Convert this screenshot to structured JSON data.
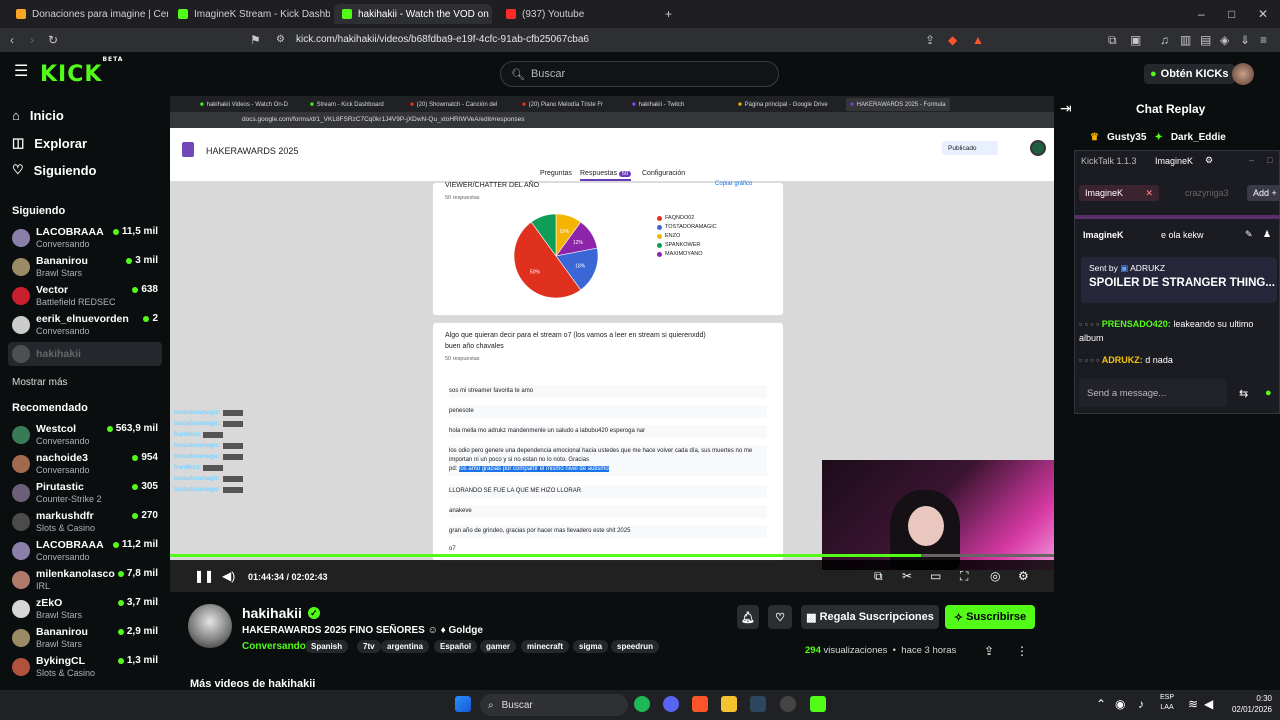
{
  "browser": {
    "tabs": [
      {
        "label": "Donaciones para imagine | Ceneka",
        "color": "#f6a623"
      },
      {
        "label": "ImagineK Stream - Kick Dashboar",
        "color": "#53fc18"
      },
      {
        "label": "hakihakii - Watch the VOD on",
        "color": "#53fc18"
      },
      {
        "label": "(937) Youtube",
        "color": "#ff2a2a"
      }
    ],
    "url": "kick.com/hakihakii/videos/b68fdba9-e19f-4cfc-91ab-cfb25067cba6"
  },
  "header": {
    "logo": "KICK",
    "logo_sup": "BETA",
    "search_placeholder": "Buscar",
    "kicks_button": "Obtén KICKs"
  },
  "sidebar": {
    "nav": [
      {
        "label": "Inicio",
        "icon": "home-icon"
      },
      {
        "label": "Explorar",
        "icon": "compass-icon"
      },
      {
        "label": "Siguiendo",
        "icon": "heart-icon"
      }
    ],
    "following_title": "Siguiendo",
    "following": [
      {
        "name": "LACOBRAAA",
        "category": "Conversando",
        "viewers": "11,5 mil",
        "color": "#8a7fa8"
      },
      {
        "name": "Bananirou",
        "category": "Brawl Stars",
        "viewers": "3 mil",
        "color": "#9b8a66"
      },
      {
        "name": "Vector",
        "category": "Battlefield REDSEC",
        "viewers": "638",
        "color": "#c8202c"
      },
      {
        "name": "eerik_elnuevorden",
        "category": "Conversando",
        "viewers": "2",
        "color": "#cccccc"
      },
      {
        "name": "hakihakii",
        "category": "",
        "viewers": "",
        "color": "#6a6a6a"
      }
    ],
    "show_more": "Mostrar más",
    "recommended_title": "Recomendado",
    "recommended": [
      {
        "name": "Westcol",
        "category": "Conversando",
        "viewers": "563,9 mil",
        "color": "#3b7a57"
      },
      {
        "name": "nachoide3",
        "category": "Conversando",
        "viewers": "954",
        "color": "#a36b4e"
      },
      {
        "name": "Pirutastic",
        "category": "Counter-Strike 2",
        "viewers": "305",
        "color": "#6b5f7a"
      },
      {
        "name": "markushdfr",
        "category": "Slots & Casino",
        "viewers": "270",
        "color": "#4b4b4b"
      },
      {
        "name": "LACOBRAAA",
        "category": "Conversando",
        "viewers": "11,2 mil",
        "color": "#8a7fa8"
      },
      {
        "name": "milenkanolasco",
        "category": "IRL",
        "viewers": "7,8 mil",
        "color": "#b07a6a"
      },
      {
        "name": "zEkO",
        "category": "Brawl Stars",
        "viewers": "3,7 mil",
        "color": "#d6d6d6"
      },
      {
        "name": "Bananirou",
        "category": "Brawl Stars",
        "viewers": "2,9 mil",
        "color": "#9b8a66"
      },
      {
        "name": "BykingCL",
        "category": "Slots & Casino",
        "viewers": "1,3 mil",
        "color": "#b0523d"
      }
    ]
  },
  "video": {
    "inner_tabs": [
      "hakihakii Videos - Watch On-D",
      "Stream - Kick Dashboard",
      "(20) Showmatch - Canción del",
      "(20) Piano Melodía Triste Fr",
      "hakihakii - Twitch",
      "Página principal - Google Drive",
      "HAKERAWARDS 2025 - Formula"
    ],
    "inner_url": "docs.google.com/forms/d/1_VKL8FSRzC7Cq0kr1J4V9P-jXDwN-Qu_xtoHRIWVeA/edit#responses",
    "form_title": "HAKERAWARDS 2025",
    "form_tabs": {
      "questions": "Preguntas",
      "responses": "Respuestas",
      "responses_count": "50",
      "settings": "Configuración"
    },
    "publish_label": "Publicado",
    "q1_title": "VIEWER/CHATTER DEL AÑO",
    "q1_count": "50 respuestas",
    "copy_chart": "Copiar gráfico",
    "pie_legend": [
      "FAQNDO02",
      "TOSTADORAMAGIC",
      "ENZO",
      "SPANKOWER",
      "MAXIMOYANO"
    ],
    "q2_title": "Algo que quieran decir para el stream o7 (los vamos a leer en stream si quierenxdd)",
    "q2_title2": "buen año chavales",
    "q2_count": "50 respuestas",
    "responses": [
      "sos mi streamer favorita te amo",
      "penesote",
      "hola mella mo adrukz mandenmenle un saludo a labubu420 esperoga nar",
      "los odio pero genere una dependencia emocional hacia ustedes que me hace volver cada día, sus muertes no me importan ni un poco y si no estan no lo noto. Gracias",
      "pd:",
      "los amo gracias por compartir el mismo nivel de autismo",
      "LLORANDO SE FUE LA QUE ME HIZO LLORAR",
      "anakeve",
      "gran año de grindeo, gracias por hacer mas llevadero este shit 2025",
      "o7"
    ],
    "overlay_chat": [
      "tostadoramagic:",
      "tostadoramagic:",
      "fran96xd:",
      "tostadoramagic:",
      "tostadoramagic:",
      "fran96xd:",
      "tostadoramagic:",
      "tostadoramagic:"
    ],
    "timecode": "01:44:34 / 02:02:43",
    "progress": 0.85
  },
  "chart_data": {
    "type": "pie",
    "title": "VIEWER/CHATTER DEL AÑO",
    "categories": [
      "FAQNDO02",
      "TOSTADORAMAGIC",
      "ENZO",
      "SPANKOWER",
      "MAXIMOYANO"
    ],
    "values": [
      50,
      18,
      10,
      10,
      12
    ],
    "colors": [
      "#e0301e",
      "#3b67d6",
      "#f4b400",
      "#0f9d58",
      "#8e24aa"
    ],
    "labels": [
      "50%",
      "18%",
      "10%",
      "",
      "12%"
    ]
  },
  "chat": {
    "title": "Chat Replay",
    "user1": "Gusty35",
    "user2": "Dark_Eddie",
    "kicktalk_title": "KickTalk 1.1.3",
    "kicktalk_user": "ImagineK",
    "tab1": "ImagineK",
    "tab2": "crazyniga3",
    "add": "Add",
    "chan_name": "ImagineK",
    "chan_title": "e ola kekw",
    "sent_by": "Sent by",
    "sender": "ADRUKZ",
    "pinned": "SPOILER DE STRANGER THING...",
    "msg1_user": "PRENSADO420:",
    "msg1_text": "leakeando su ultimo album",
    "msg2_user": "ADRUKZ:",
    "msg2_text": "d nada",
    "input_placeholder": "Send a message..."
  },
  "channel": {
    "name": "hakihakii",
    "title": "HAKERAWARDS 2025 FINO SEÑORES",
    "game_suffix": "Goldge",
    "category": "Conversando",
    "tags": [
      "Spanish",
      "7tv",
      "argentina",
      "Español",
      "gamer",
      "minecraft",
      "sigma",
      "speedrun"
    ],
    "gift_button": "Regala Suscripciones",
    "sub_button": "Suscribirse",
    "views_count": "294",
    "views_label": "visualizaciones",
    "ago": "hace 3 horas",
    "more_videos": "Más videos de hakihakii"
  },
  "taskbar": {
    "search": "Buscar",
    "lang1": "ESP",
    "lang2": "LAA",
    "time": "0:30",
    "date": "02/01/2026"
  }
}
